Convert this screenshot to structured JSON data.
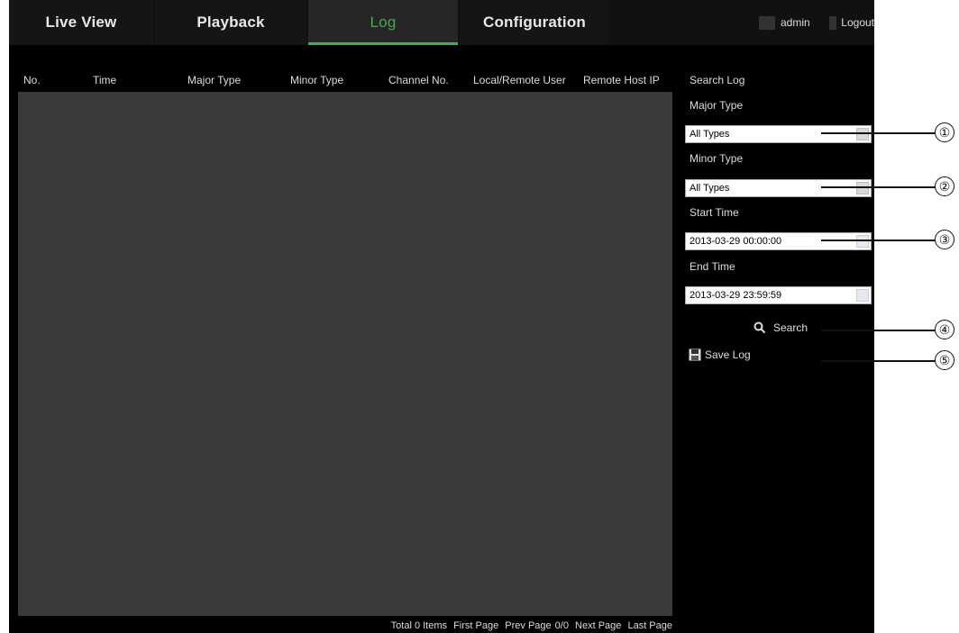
{
  "nav": {
    "tabs": [
      {
        "label": "Live View"
      },
      {
        "label": "Playback"
      },
      {
        "label": "Log"
      },
      {
        "label": "Configuration"
      }
    ],
    "active_tab": "Log",
    "user": "admin",
    "logout": "Logout"
  },
  "log_table": {
    "columns": [
      "No.",
      "Time",
      "Major Type",
      "Minor Type",
      "Channel No.",
      "Local/Remote User",
      "Remote Host IP"
    ],
    "rows": []
  },
  "pager": {
    "total": "Total 0 Items",
    "first": "First Page",
    "prev": "Prev Page",
    "page": "0/0",
    "next": "Next Page",
    "last": "Last Page"
  },
  "search_panel": {
    "title": "Search Log",
    "major_type_label": "Major Type",
    "major_type_value": "All Types",
    "minor_type_label": "Minor Type",
    "minor_type_value": "All Types",
    "start_time_label": "Start Time",
    "start_time_value": "2013-03-29 00:00:00",
    "end_time_label": "End Time",
    "end_time_value": "2013-03-29 23:59:59",
    "search_label": "Search",
    "save_label": "Save Log"
  },
  "callouts": [
    "①",
    "②",
    "③",
    "④",
    "⑤"
  ],
  "colors": {
    "accent": "#3bb34a",
    "background": "#000000",
    "table_bg": "#3a3a3a"
  },
  "icons": [
    "user-icon",
    "logout-icon",
    "dropdown-icon",
    "calendar-icon",
    "search-icon",
    "save-icon"
  ]
}
